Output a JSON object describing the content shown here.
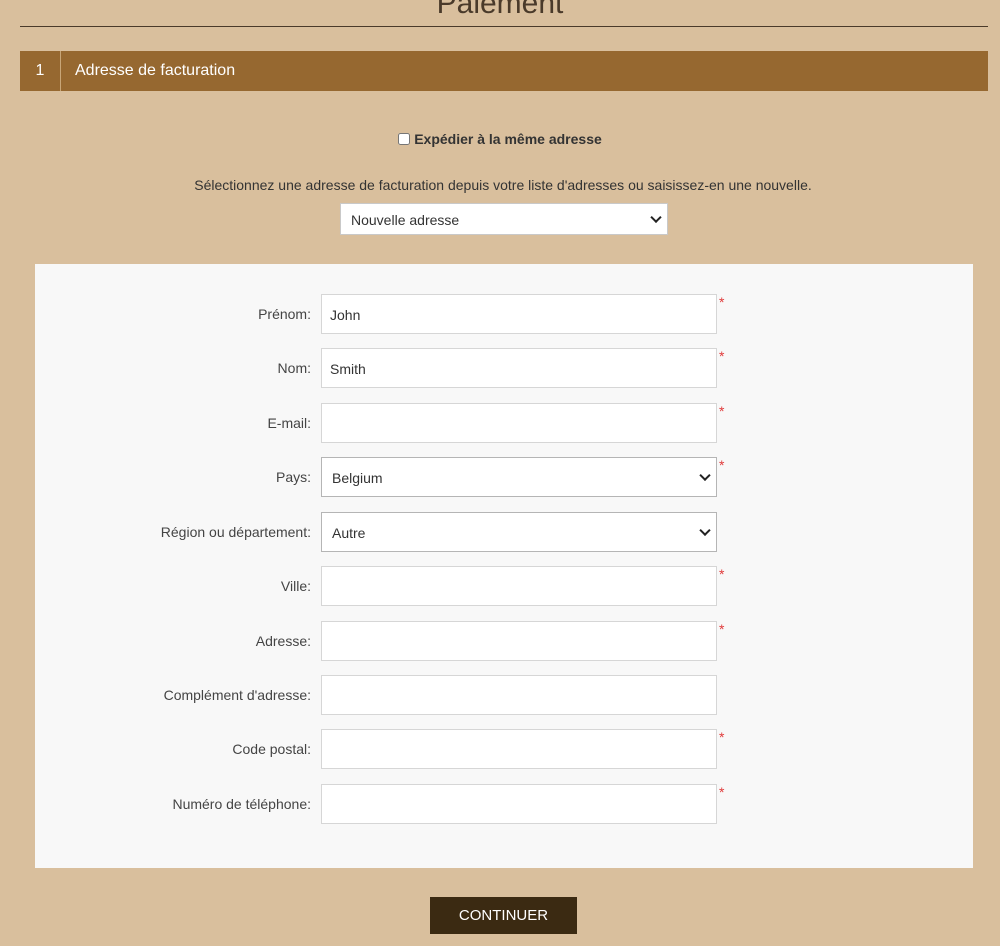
{
  "page": {
    "title": "Paiement"
  },
  "step": {
    "number": "1",
    "title": "Adresse de facturation"
  },
  "ship_same": {
    "label": "Expédier à la même adresse",
    "checked": false
  },
  "address_select": {
    "instruction": "Sélectionnez une adresse de facturation depuis votre liste d'adresses ou saisissez-en une nouvelle.",
    "selected": "Nouvelle adresse"
  },
  "form": {
    "required_mark": "*",
    "fields": {
      "first_name": {
        "label": "Prénom:",
        "value": "John",
        "required": true
      },
      "last_name": {
        "label": "Nom:",
        "value": "Smith",
        "required": true
      },
      "email": {
        "label": "E-mail:",
        "value": "",
        "required": true
      },
      "country": {
        "label": "Pays:",
        "value": "Belgium",
        "required": true
      },
      "region": {
        "label": "Région ou département:",
        "value": "Autre",
        "required": false
      },
      "city": {
        "label": "Ville:",
        "value": "",
        "required": true
      },
      "address": {
        "label": "Adresse:",
        "value": "",
        "required": true
      },
      "address2": {
        "label": "Complément d'adresse:",
        "value": "",
        "required": false
      },
      "postal_code": {
        "label": "Code postal:",
        "value": "",
        "required": true
      },
      "phone": {
        "label": "Numéro de téléphone:",
        "value": "",
        "required": true
      }
    }
  },
  "continue_button": {
    "label": "CONTINUER"
  },
  "colors": {
    "background": "#d9bf9d",
    "step_bar": "#966830",
    "button": "#3b2a12",
    "required": "#e03a3a"
  }
}
